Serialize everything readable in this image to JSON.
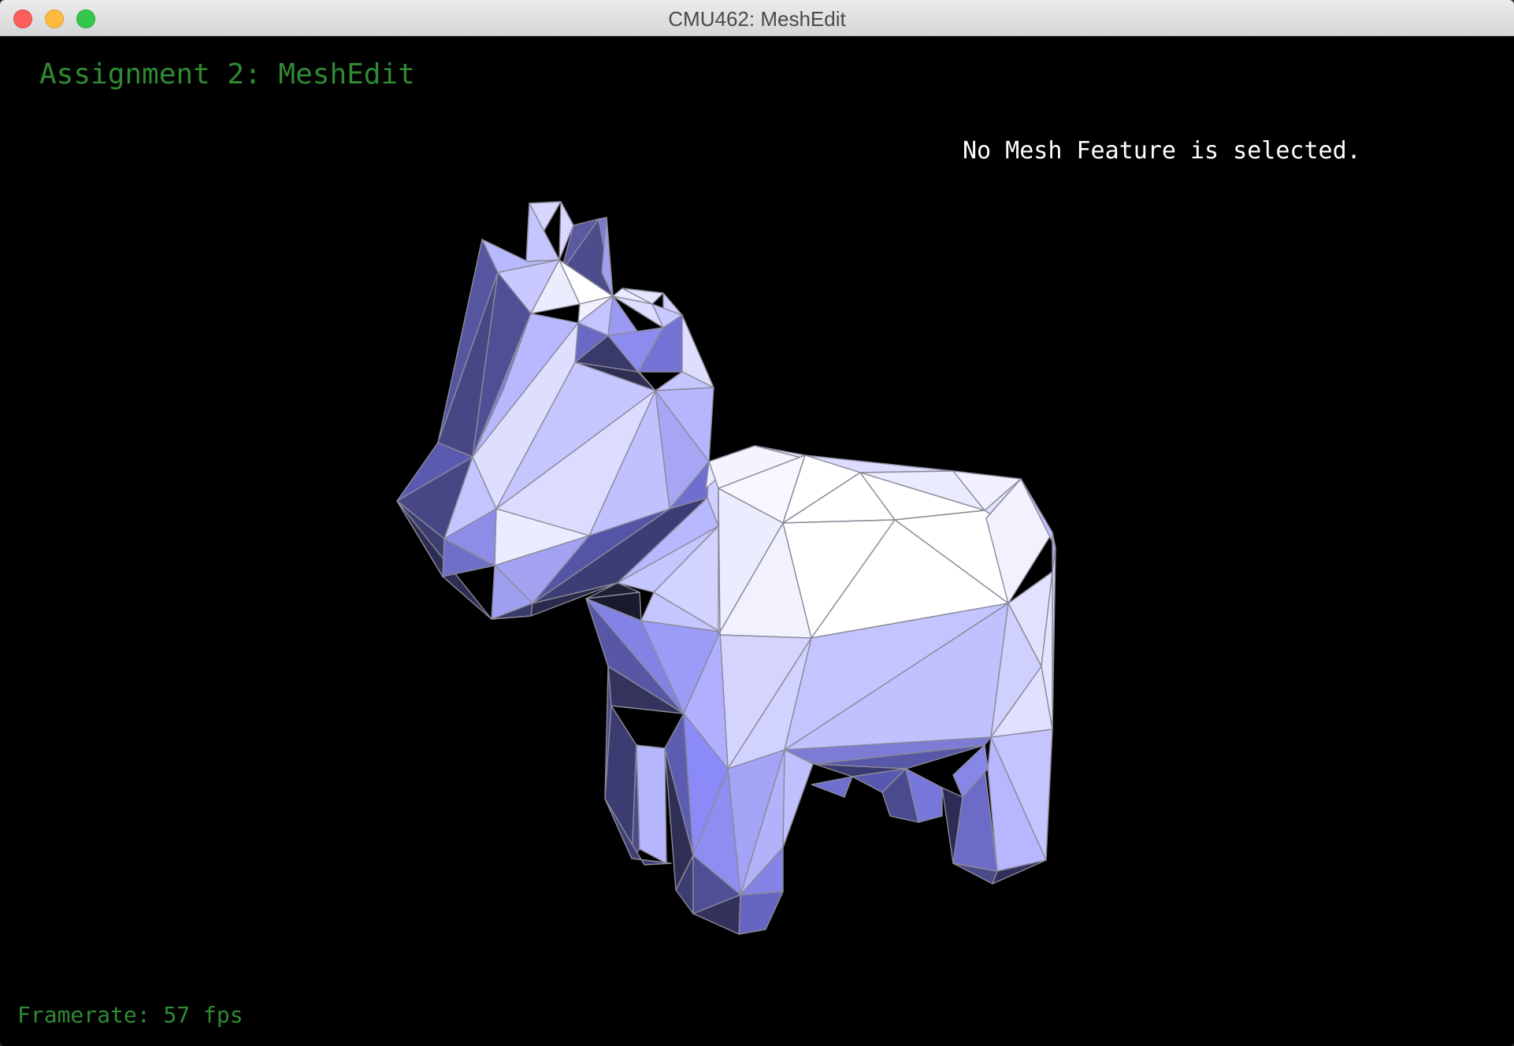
{
  "window": {
    "title": "CMU462: MeshEdit"
  },
  "viewport": {
    "header": "Assignment 2: MeshEdit",
    "selection_status": "No Mesh Feature is selected.",
    "framerate": "Framerate: 57 fps"
  },
  "colors": {
    "header_text": "#2f8a33",
    "status_text": "#ffffff",
    "background": "#000000",
    "mesh_base": "#c4c4ff",
    "mesh_edge": "#8a8a99"
  },
  "icons": [
    "close-window-icon",
    "minimize-window-icon",
    "maximize-window-icon"
  ]
}
